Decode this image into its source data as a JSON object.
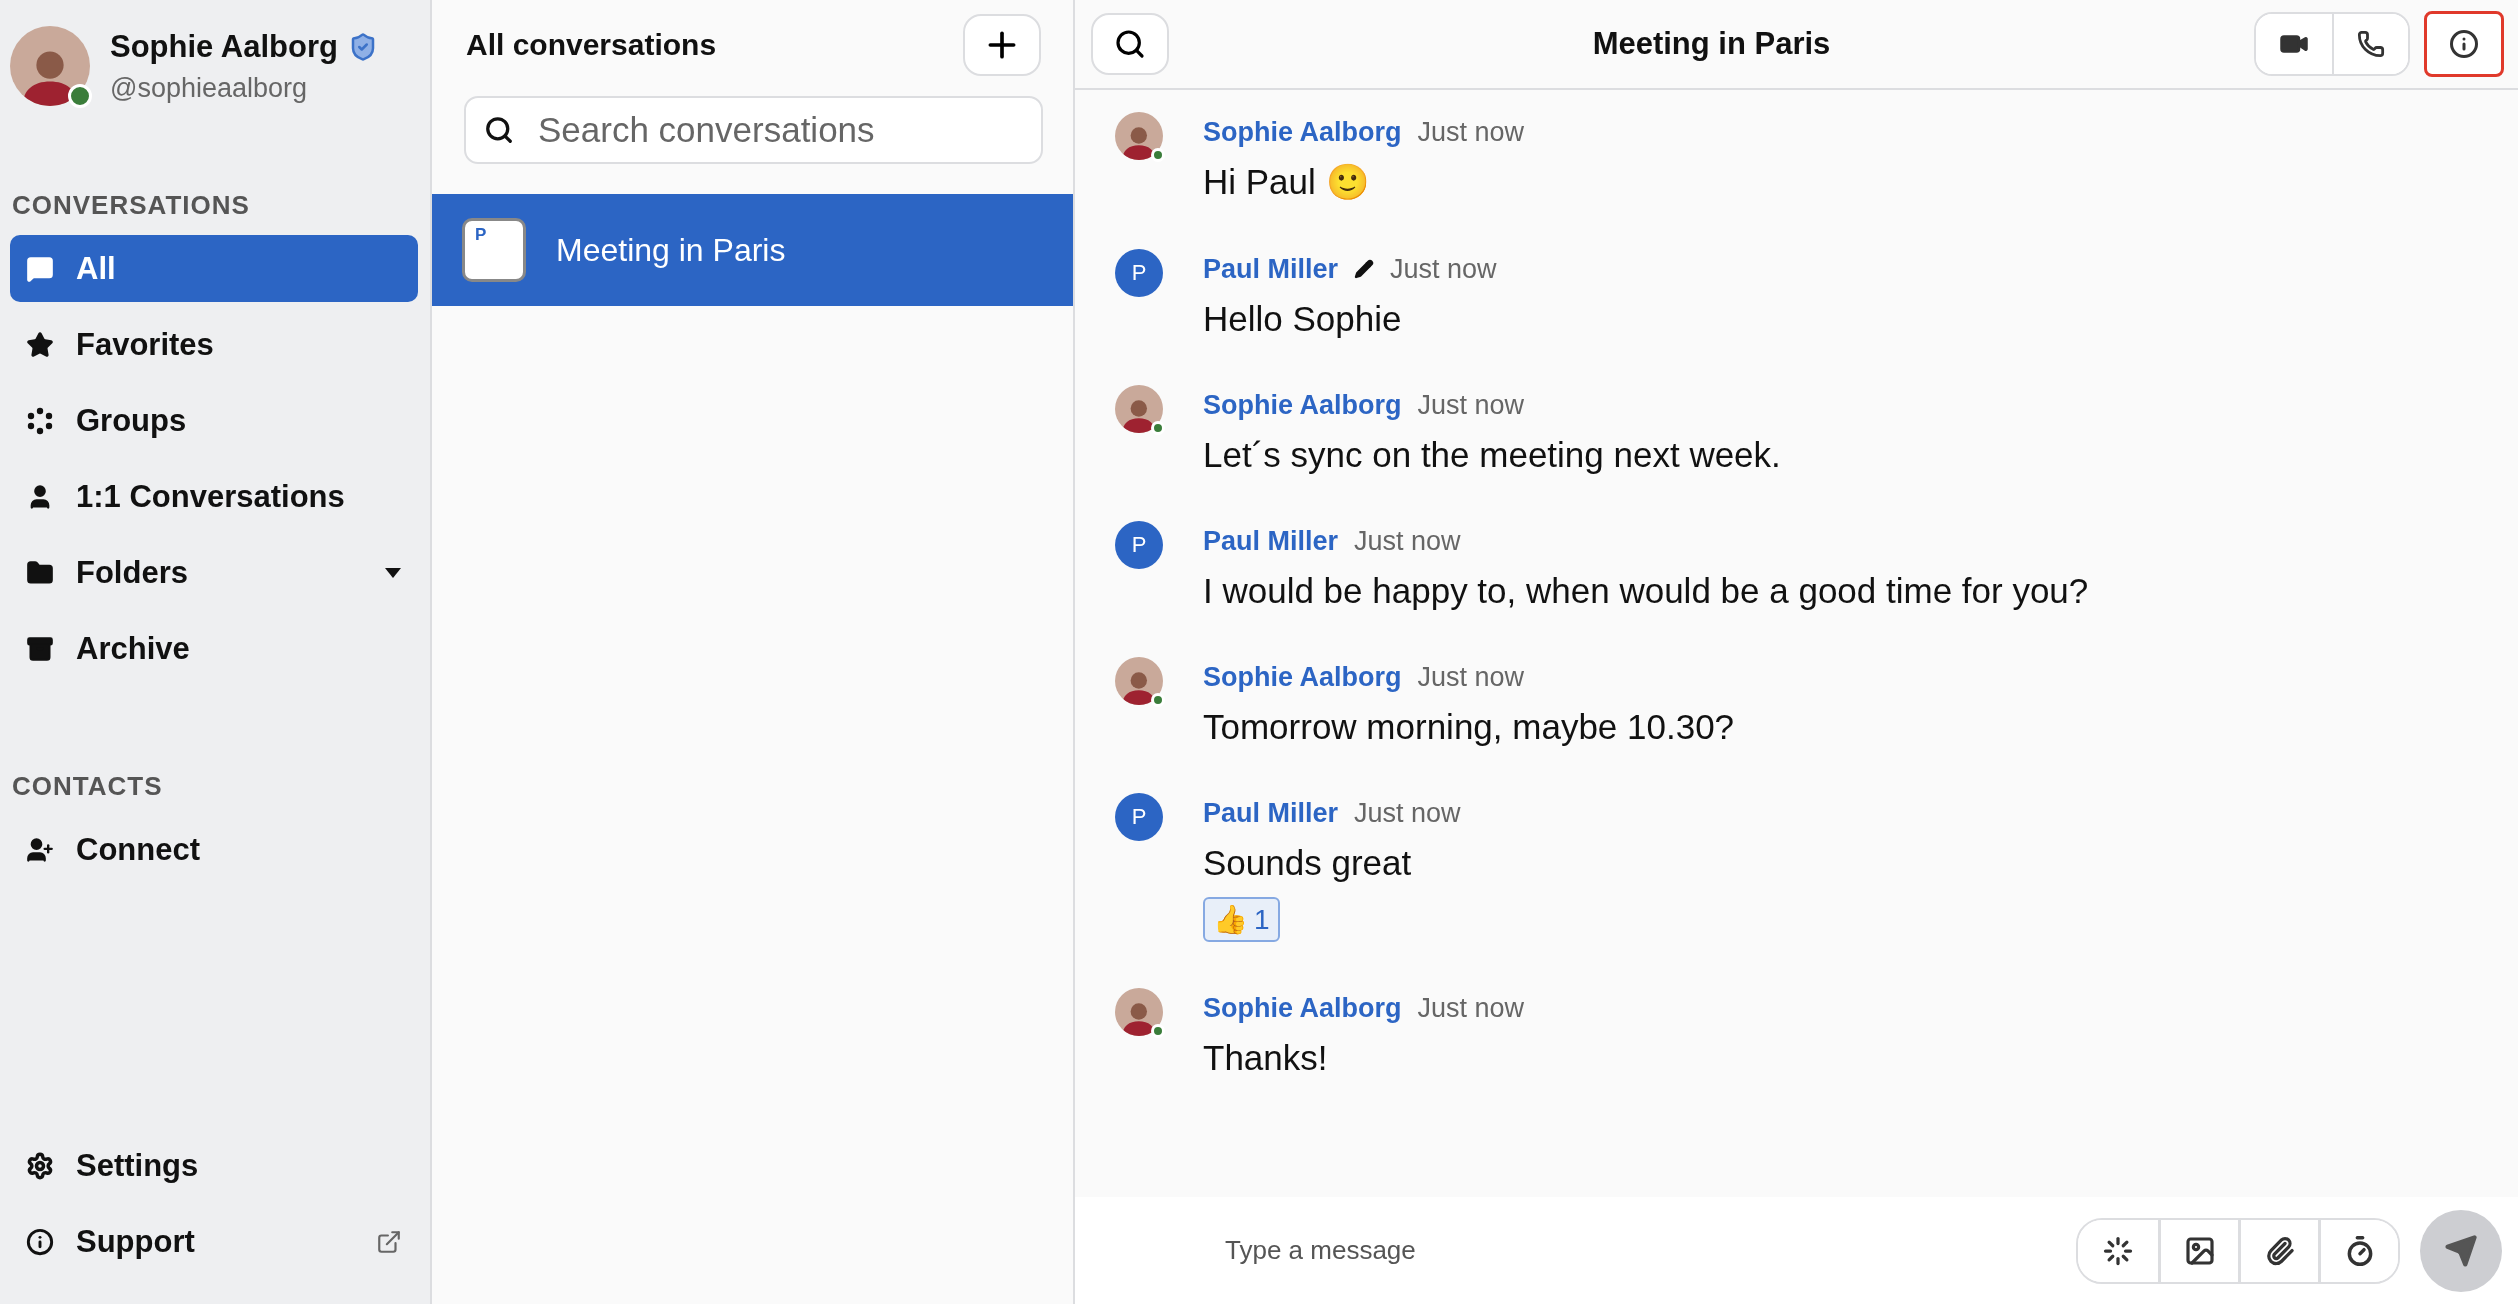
{
  "profile": {
    "name": "Sophie Aalborg",
    "handle": "@sophieaalborg",
    "verified": true,
    "online": true
  },
  "sidebar": {
    "sections": [
      {
        "title": "CONVERSATIONS",
        "items": [
          {
            "label": "All",
            "selected": true,
            "dropdown": false
          },
          {
            "label": "Favorites",
            "selected": false,
            "dropdown": false
          },
          {
            "label": "Groups",
            "selected": false,
            "dropdown": false
          },
          {
            "label": "1:1 Conversations",
            "selected": false,
            "dropdown": false
          },
          {
            "label": "Folders",
            "selected": false,
            "dropdown": true
          },
          {
            "label": "Archive",
            "selected": false,
            "dropdown": false
          }
        ]
      },
      {
        "title": "CONTACTS",
        "items": [
          {
            "label": "Connect",
            "selected": false,
            "dropdown": false
          }
        ]
      }
    ],
    "footer": [
      {
        "label": "Settings",
        "external": false
      },
      {
        "label": "Support",
        "external": true
      }
    ]
  },
  "conversation_list": {
    "title": "All conversations",
    "search": {
      "placeholder": "Search conversations"
    },
    "items": [
      {
        "title": "Meeting in Paris",
        "initial": "P",
        "selected": true
      }
    ]
  },
  "chat": {
    "title": "Meeting in Paris",
    "info_highlighted": true,
    "messages": [
      {
        "author": "Sophie Aalborg",
        "kind": "photo",
        "online": true,
        "edited": false,
        "time": "Just now",
        "text": "Hi Paul 🙂"
      },
      {
        "author": "Paul Miller",
        "kind": "initial",
        "initial": "P",
        "online": false,
        "edited": true,
        "time": "Just now",
        "text": "Hello Sophie"
      },
      {
        "author": "Sophie Aalborg",
        "kind": "photo",
        "online": true,
        "edited": false,
        "time": "Just now",
        "text": "Let´s sync on the meeting next week."
      },
      {
        "author": "Paul Miller",
        "kind": "initial",
        "initial": "P",
        "online": false,
        "edited": false,
        "time": "Just now",
        "text": "I would be happy to, when would be a good time for you?"
      },
      {
        "author": "Sophie Aalborg",
        "kind": "photo",
        "online": true,
        "edited": false,
        "time": "Just now",
        "text": "Tomorrow morning, maybe 10.30?"
      },
      {
        "author": "Paul Miller",
        "kind": "initial",
        "initial": "P",
        "online": false,
        "edited": false,
        "time": "Just now",
        "text": "Sounds great",
        "reactions": [
          {
            "emoji": "👍",
            "count": "1"
          }
        ]
      },
      {
        "author": "Sophie Aalborg",
        "kind": "photo",
        "online": true,
        "edited": false,
        "time": "Just now",
        "text": "Thanks!"
      }
    ],
    "composer": {
      "placeholder": "Type a message"
    }
  }
}
